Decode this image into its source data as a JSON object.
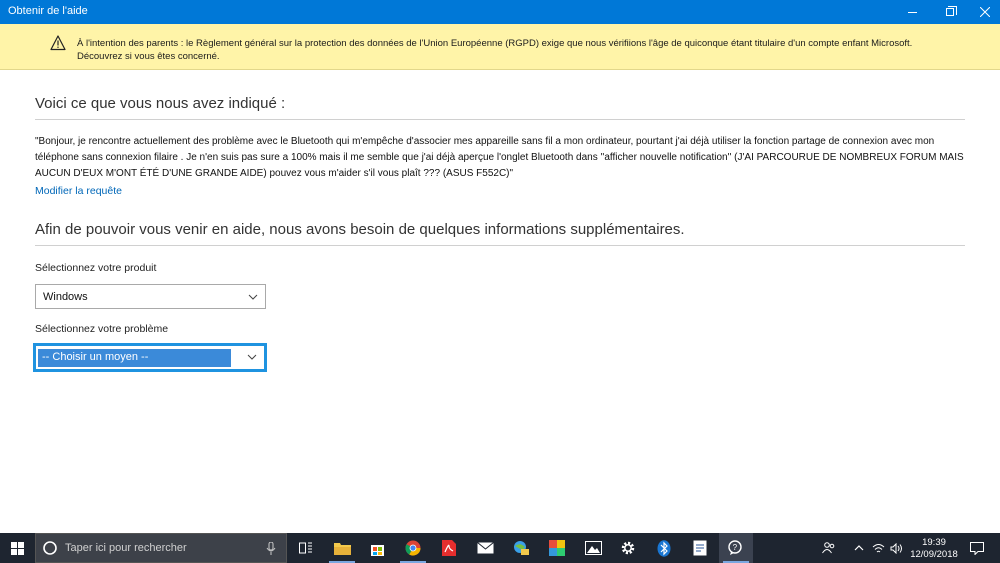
{
  "window": {
    "title": "Obtenir de l'aide"
  },
  "banner": {
    "line1": "À l'intention des parents : le Règlement général sur la protection des données de l'Union Européenne (RGPD) exige que nous vérifiions l'âge de quiconque étant titulaire d'un compte enfant Microsoft.",
    "line2": "Découvrez si vous êtes concerné."
  },
  "summary": {
    "heading": "Voici ce que vous nous avez indiqué :",
    "request": "\"Bonjour, je rencontre actuellement des problème avec le Bluetooth qui m'empêche d'associer mes appareille sans fil a mon ordinateur, pourtant j'ai déjà utiliser la fonction partage de connexion avec mon téléphone sans connexion filaire . Je n'en suis pas sure a 100% mais il me semble que j'ai déjà aperçue l'onglet Bluetooth dans ''afficher nouvelle notification'' (J'AI PARCOURUE DE NOMBREUX FORUM MAIS AUCUN D'EUX M'ONT ÉTÉ D'UNE GRANDE AIDE) pouvez vous m'aider s'il vous plaît ??? (ASUS F552C)\"",
    "edit_link": "Modifier la requête"
  },
  "info": {
    "heading": "Afin de pouvoir vous venir en aide, nous avons besoin de quelques informations supplémentaires.",
    "product_label": "Sélectionnez votre produit",
    "product_value": "Windows",
    "problem_label": "Sélectionnez votre problème",
    "problem_value": "-- Choisir un moyen --"
  },
  "taskbar": {
    "search_placeholder": "Taper ici pour rechercher",
    "time": "19:39",
    "date": "12/09/2018"
  },
  "colors": {
    "titlebar": "#0078d7",
    "banner": "#fff4a8",
    "link": "#0067b8",
    "focus": "#1f93e0",
    "taskbar": "#1e2530"
  }
}
